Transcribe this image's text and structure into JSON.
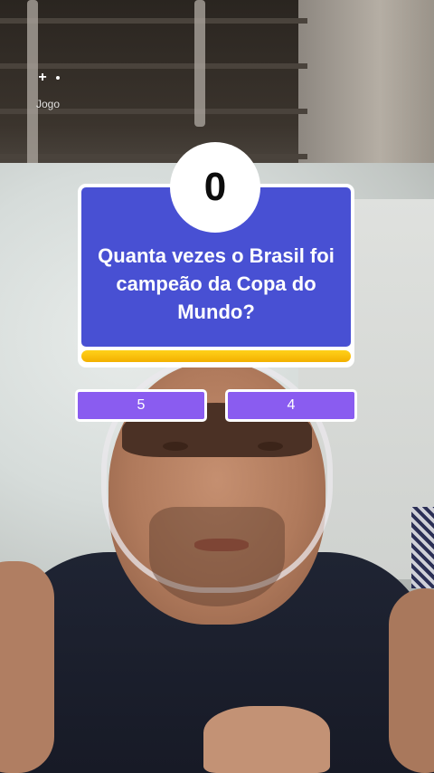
{
  "top_overlay": {
    "icon": "effect-menu-icon",
    "label": "Jogo"
  },
  "quiz": {
    "score": "0",
    "question": "Quanta vezes o Brasil foi campeão da Copa do Mundo?",
    "timer_progress_percent": 100,
    "answers": [
      {
        "label": "5"
      },
      {
        "label": "4"
      }
    ]
  },
  "colors": {
    "card_blue": "#4850d3",
    "answer_purple": "#8a5cf0",
    "timer_yellow": "#ffd11a"
  }
}
